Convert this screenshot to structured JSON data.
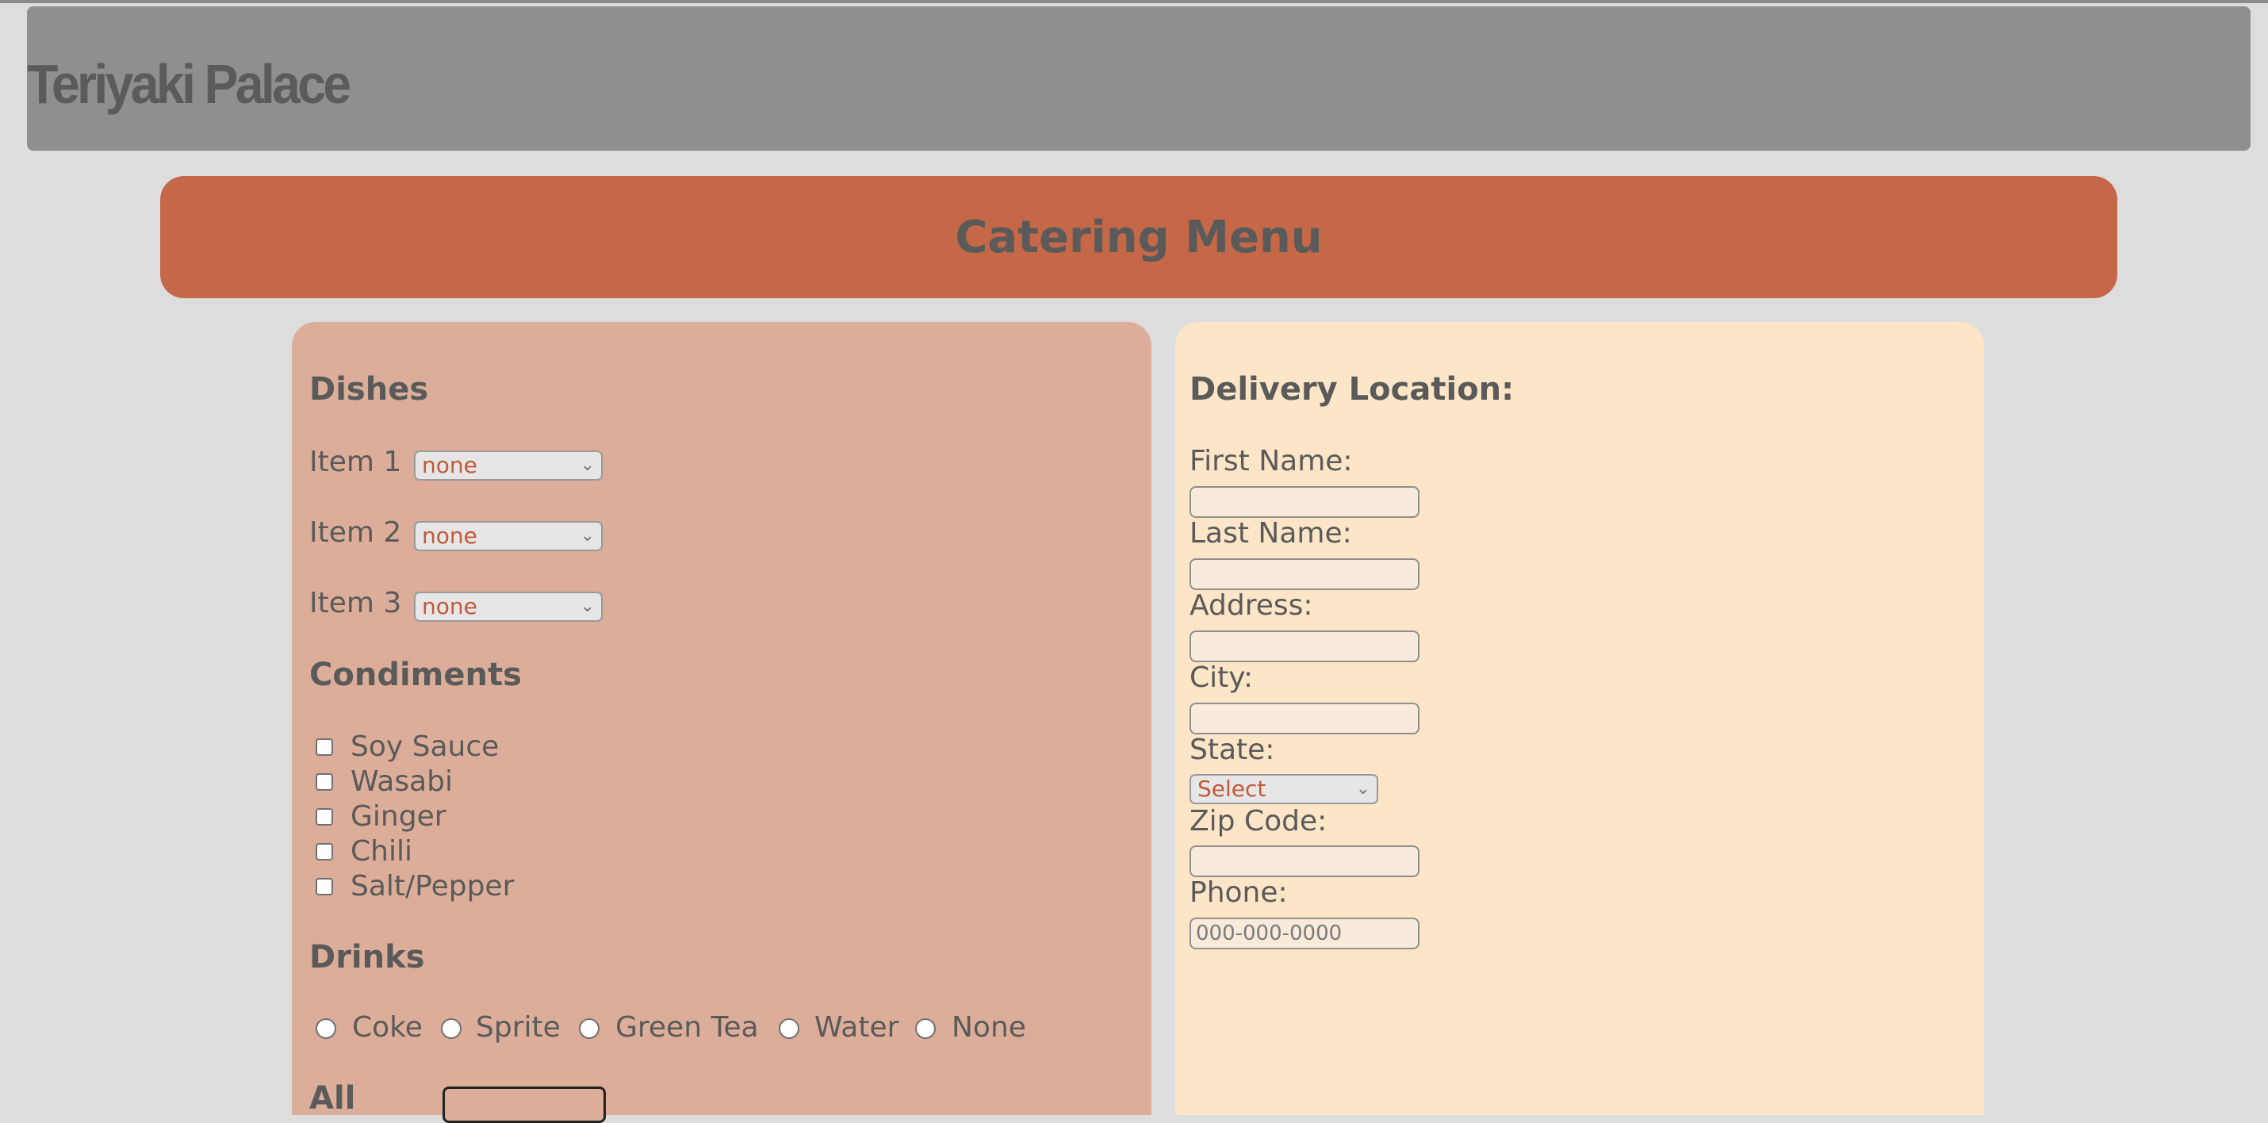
{
  "header": {
    "brand": "Teriyaki Palace"
  },
  "banner": {
    "title": "Catering Menu"
  },
  "dishes": {
    "heading": "Dishes",
    "items": [
      {
        "label": "Item 1",
        "value": "none"
      },
      {
        "label": "Item 2",
        "value": "none"
      },
      {
        "label": "Item 3",
        "value": "none"
      }
    ]
  },
  "condiments": {
    "heading": "Condiments",
    "options": [
      "Soy Sauce",
      "Wasabi",
      "Ginger",
      "Chili",
      "Salt/Pepper"
    ]
  },
  "drinks": {
    "heading": "Drinks",
    "options": [
      "Coke",
      "Sprite",
      "Green Tea",
      "Water",
      "None"
    ]
  },
  "partial": {
    "label": "All"
  },
  "delivery": {
    "heading": "Delivery Location:",
    "first_name_label": "First Name:",
    "last_name_label": "Last Name:",
    "address_label": "Address:",
    "city_label": "City:",
    "state_label": "State:",
    "state_value": "Select",
    "zip_label": "Zip Code:",
    "phone_label": "Phone:",
    "phone_placeholder": "000-000-0000"
  },
  "colors": {
    "background": "#dddddd",
    "header": "#8f8f8f",
    "banner": "#c46848",
    "left_panel": "#dcae9a",
    "right_panel": "#fde5c7",
    "select_text": "#c15a38"
  }
}
